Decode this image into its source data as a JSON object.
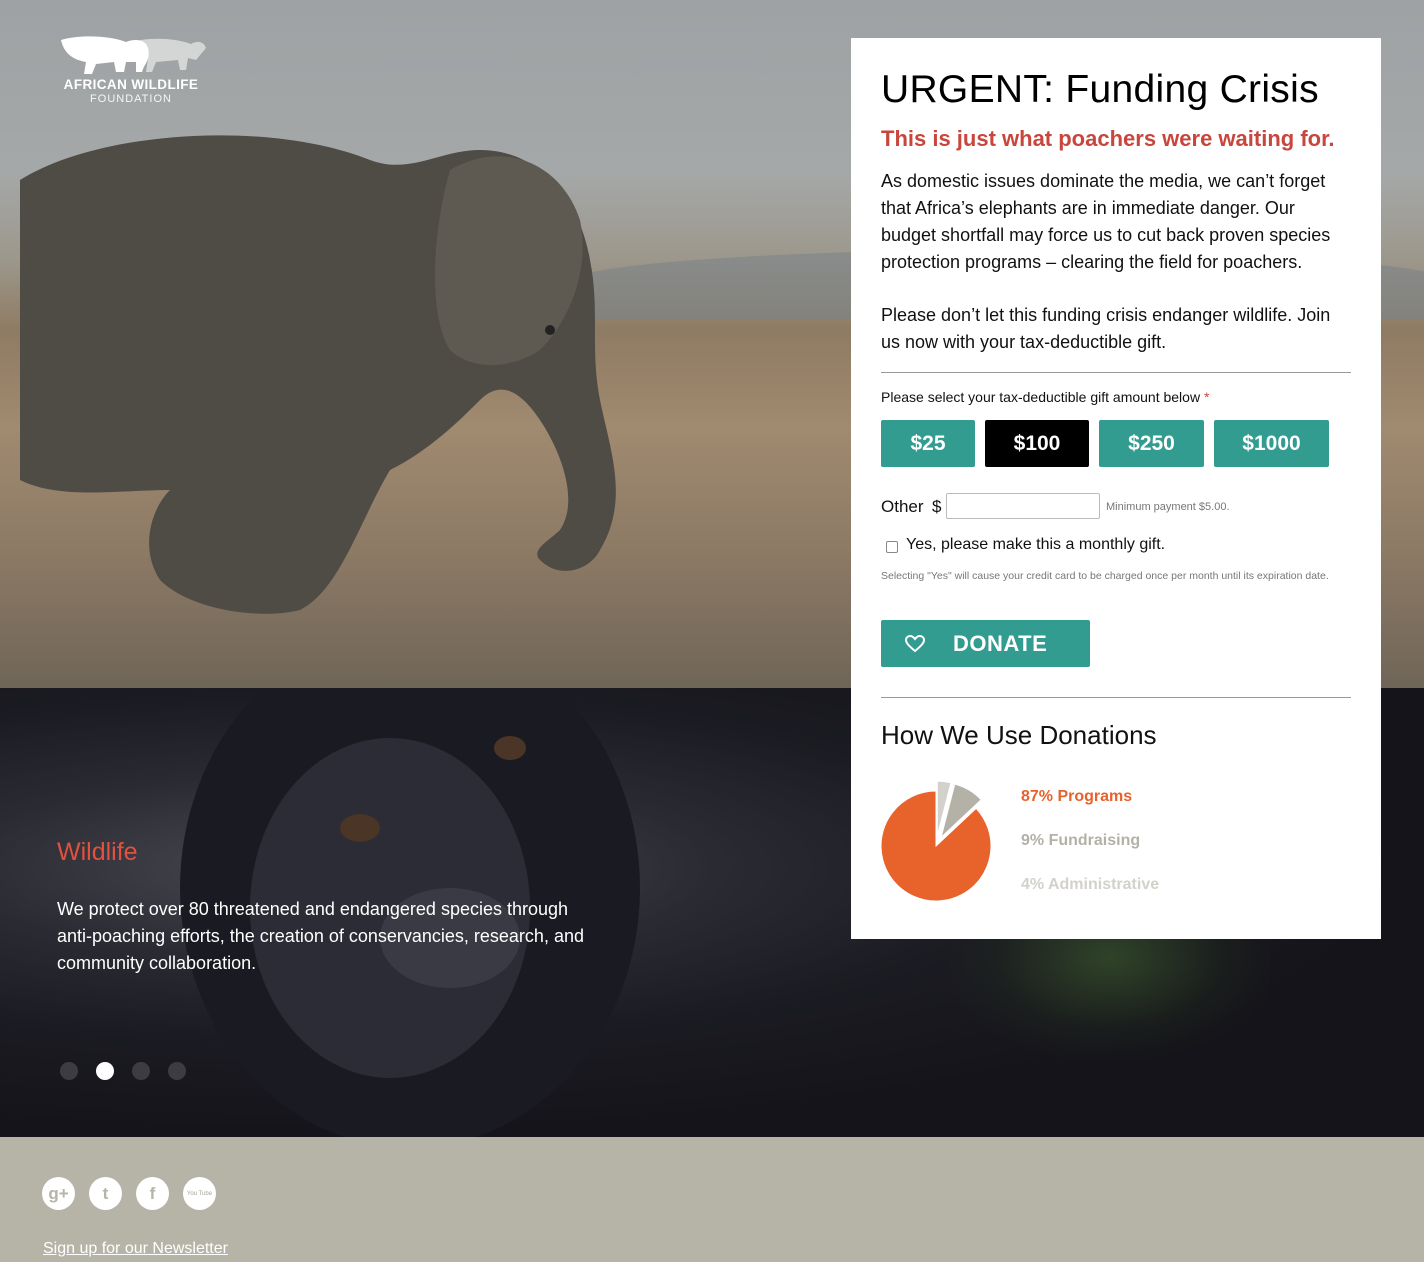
{
  "logo": {
    "name": "AFRICAN WILDLIFE",
    "sub": "FOUNDATION"
  },
  "panel": {
    "title": "URGENT: Funding Crisis",
    "subtitle": "This is just what poachers were waiting for.",
    "paragraph1": "As domestic issues dominate the media, we can’t forget that Africa’s elephants are in immediate danger. Our budget shortfall may force us to cut back proven species protection programs – clearing the field for poachers.",
    "paragraph2": "Please don’t let this funding crisis endanger wildlife. Join us now with your tax-deductible gift.",
    "select_label": "Please select your tax-deductible gift amount below",
    "required_mark": "*",
    "amounts": [
      "$25",
      "$100",
      "$250",
      "$1000"
    ],
    "selected_amount": "$100",
    "other_label": "Other",
    "currency_symbol": "$",
    "other_value": "",
    "min_payment": "Minimum payment $5.00.",
    "monthly_label": "Yes, please make this a monthly gift.",
    "monthly_checked": false,
    "monthly_note": "Selecting \"Yes\" will cause your credit card to be charged once per month until its expiration date.",
    "donate_label": "DONATE",
    "donations_heading": "How We Use Donations",
    "breakdown": [
      {
        "label": "87% Programs",
        "percent": 87,
        "color": "#e8622b"
      },
      {
        "label": "9% Fundraising",
        "percent": 9,
        "color": "#b4b1a6"
      },
      {
        "label": "4% Administrative",
        "percent": 4,
        "color": "#d3d1cb"
      }
    ]
  },
  "slide": {
    "title": "Wildlife",
    "text": "We protect over 80 threatened and endangered species through anti-poaching efforts, the creation of conservancies, research, and community collaboration.",
    "dot_count": 4,
    "active_dot": 1
  },
  "footer": {
    "social": [
      {
        "name": "google-plus-icon",
        "glyph": "g+"
      },
      {
        "name": "twitter-icon",
        "glyph": "t"
      },
      {
        "name": "facebook-icon",
        "glyph": "f"
      },
      {
        "name": "youtube-icon",
        "glyph": "You Tube"
      }
    ],
    "newsletter_link": "Sign up for our Newsletter"
  }
}
